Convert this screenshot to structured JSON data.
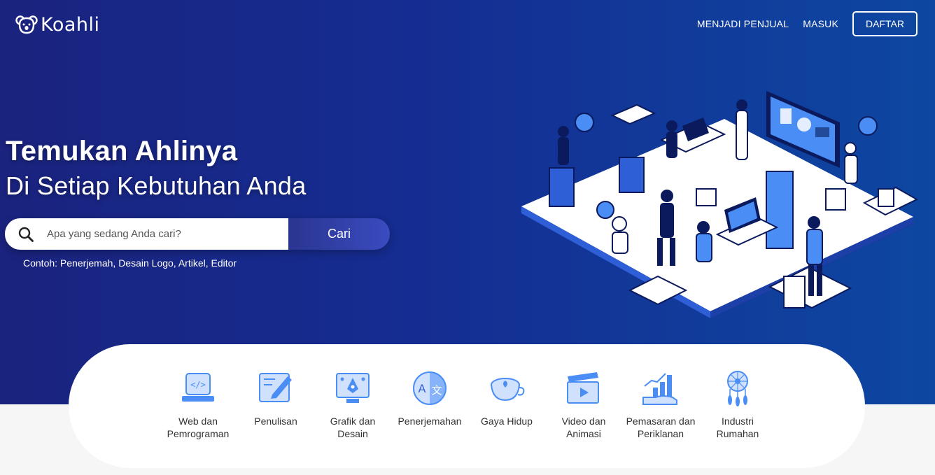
{
  "brand": {
    "name": "Koahli"
  },
  "nav": {
    "seller_label": "MENJADI PENJUAL",
    "login_label": "MASUK",
    "register_label": "DAFTAR"
  },
  "hero": {
    "title": "Temukan Ahlinya",
    "subtitle": "Di Setiap Kebutuhan Anda",
    "search_placeholder": "Apa yang sedang Anda cari?",
    "search_button": "Cari",
    "examples": "Contoh: Penerjemah, Desain Logo, Artikel, Editor"
  },
  "categories": [
    {
      "line1": "Web dan",
      "line2": "Pemrograman",
      "icon": "code-laptop-icon"
    },
    {
      "line1": "Penulisan",
      "line2": "",
      "icon": "pencil-paper-icon"
    },
    {
      "line1": "Grafik dan",
      "line2": "Desain",
      "icon": "pen-tool-monitor-icon"
    },
    {
      "line1": "Penerjemahan",
      "line2": "",
      "icon": "translate-icon"
    },
    {
      "line1": "Gaya Hidup",
      "line2": "",
      "icon": "coffee-cup-icon"
    },
    {
      "line1": "Video dan",
      "line2": "Animasi",
      "icon": "video-clapper-icon"
    },
    {
      "line1": "Pemasaran dan",
      "line2": "Periklanan",
      "icon": "growth-chart-hand-icon"
    },
    {
      "line1": "Industri",
      "line2": "Rumahan",
      "icon": "dreamcatcher-icon"
    }
  ],
  "colors": {
    "hero_start": "#1a237e",
    "hero_end": "#0d47a1",
    "button": "#2a3590",
    "icon_blue": "#4a8ef5"
  }
}
